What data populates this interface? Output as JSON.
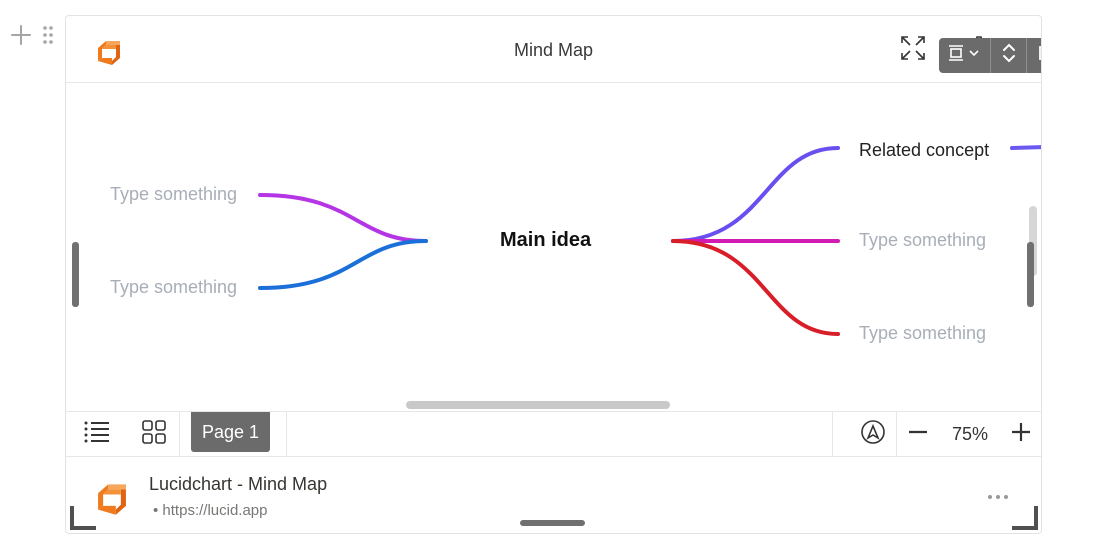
{
  "app": {
    "title": "Mind Map"
  },
  "mindmap": {
    "main": "Main idea",
    "left": [
      {
        "label": "Type something",
        "color": "#b534e6"
      },
      {
        "label": "Type something",
        "color": "#1a6fd8"
      }
    ],
    "right": [
      {
        "label": "Related concept",
        "color": "#6a4ff0"
      },
      {
        "label": "Type something",
        "color": "#d21bb5"
      },
      {
        "label": "Type something",
        "color": "#d71e29"
      }
    ],
    "offscreen_branch_color": "#6a58f0"
  },
  "bottom_bar": {
    "page_tab": "Page 1",
    "zoom": "75%",
    "icons": [
      "list-icon",
      "grid-icon",
      "compass-icon",
      "zoom-out-icon",
      "zoom-in-icon"
    ]
  },
  "link": {
    "title": "Lucidchart - Mind Map",
    "url": "• https://lucid.app"
  },
  "colors": {
    "logo_orange": "#f07a1e",
    "toolbar_bg": "#6b6b6b"
  }
}
